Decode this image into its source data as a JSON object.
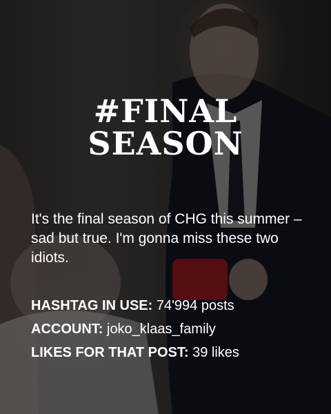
{
  "post": {
    "title_line1": "#FINAL",
    "title_line2": "SEASON",
    "caption": "It's the final season of CHG this summer – sad but true. I'm gonna miss these two idiots.",
    "stats": [
      {
        "label": "HASHTAG IN USE:",
        "value": " 74'994 posts"
      },
      {
        "label": "ACCOUNT:",
        "value": " joko_klaas_family"
      },
      {
        "label": "LIKES FOR THAT POST:",
        "value": " 39 likes"
      }
    ]
  }
}
